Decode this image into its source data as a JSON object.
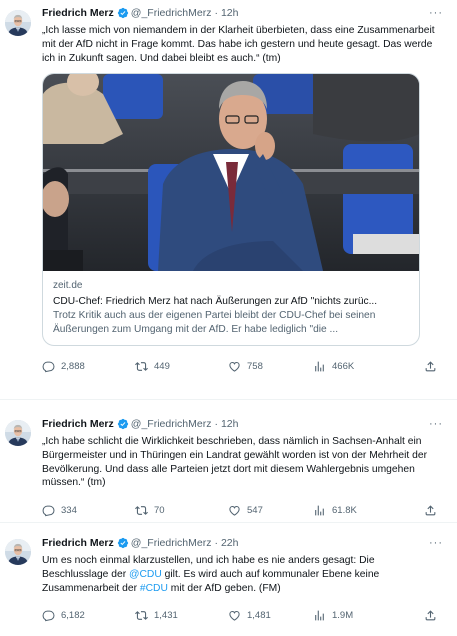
{
  "tweets": [
    {
      "author": "Friedrich Merz",
      "handle": "@_FriedrichMerz",
      "separator": "·",
      "time": "12h",
      "more": "···",
      "text": "„Ich lasse mich von niemandem in der Klarheit überbieten, dass eine Zusammenarbeit mit der AfD nicht in Frage kommt. Das habe ich gestern und heute gesagt. Das werde ich in Zukunft sagen. Und dabei bleibt es auch.“ (tm)",
      "card": {
        "domain": "zeit.de",
        "title": "CDU-Chef: Friedrich Merz hat nach Äußerungen zur AfD \"nichts zurüc...",
        "description": "Trotz Kritik auch aus der eigenen Partei bleibt der CDU-Chef bei seinen Äußerungen zum Umgang mit der AfD. Er habe lediglich \"die ..."
      },
      "replies": "2,888",
      "retweets": "449",
      "likes": "758",
      "views": "466K"
    },
    {
      "author": "Friedrich Merz",
      "handle": "@_FriedrichMerz",
      "separator": "·",
      "time": "12h",
      "more": "···",
      "text": "„Ich habe schlicht die Wirklichkeit beschrieben, dass nämlich in Sachsen-Anhalt ein Bürgermeister und in Thüringen ein Landrat gewählt worden ist von der Mehrheit der Bevölkerung. Und dass alle Parteien jetzt dort mit diesem Wahlergebnis umgehen müssen.“ (tm)",
      "replies": "334",
      "retweets": "70",
      "likes": "547",
      "views": "61.8K"
    },
    {
      "author": "Friedrich Merz",
      "handle": "@_FriedrichMerz",
      "separator": "·",
      "time": "22h",
      "more": "···",
      "text_parts": {
        "a": "Um es noch einmal klarzustellen, und ich habe es nie anders gesagt: Die Beschlusslage der ",
        "b": "@CDU",
        "c": " gilt. Es wird auch auf kommunaler Ebene keine Zusammenarbeit der ",
        "d": "#CDU",
        "e": " mit der AfD geben. (FM)"
      },
      "replies": "6,182",
      "retweets": "1,431",
      "likes": "1,481",
      "views": "1.9M"
    }
  ],
  "colors": {
    "accent": "#1d9bf0",
    "text": "#0f1419",
    "secondary": "#536471",
    "border": "#cfd9de"
  },
  "icons": [
    "verified-badge-icon",
    "reply-icon",
    "retweet-icon",
    "like-icon",
    "views-icon",
    "share-icon",
    "more-icon"
  ]
}
